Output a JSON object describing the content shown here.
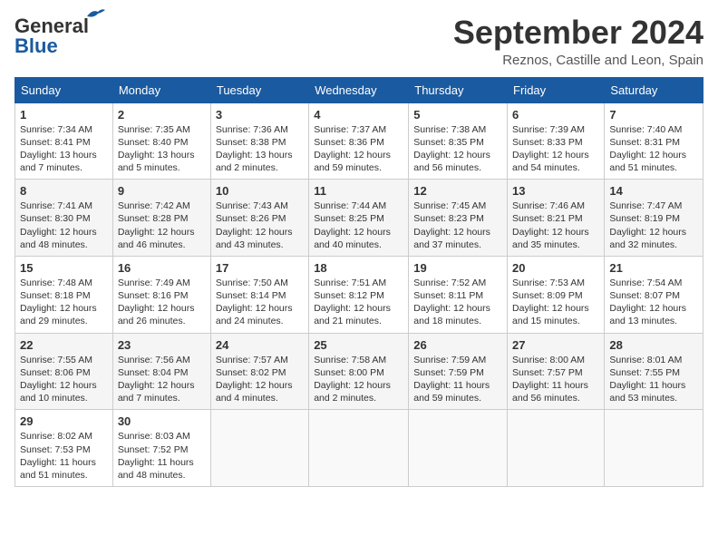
{
  "header": {
    "logo_general": "General",
    "logo_blue": "Blue",
    "month_title": "September 2024",
    "location": "Reznos, Castille and Leon, Spain"
  },
  "days_of_week": [
    "Sunday",
    "Monday",
    "Tuesday",
    "Wednesday",
    "Thursday",
    "Friday",
    "Saturday"
  ],
  "weeks": [
    [
      {
        "day": "1",
        "info": "Sunrise: 7:34 AM\nSunset: 8:41 PM\nDaylight: 13 hours and 7 minutes."
      },
      {
        "day": "2",
        "info": "Sunrise: 7:35 AM\nSunset: 8:40 PM\nDaylight: 13 hours and 5 minutes."
      },
      {
        "day": "3",
        "info": "Sunrise: 7:36 AM\nSunset: 8:38 PM\nDaylight: 13 hours and 2 minutes."
      },
      {
        "day": "4",
        "info": "Sunrise: 7:37 AM\nSunset: 8:36 PM\nDaylight: 12 hours and 59 minutes."
      },
      {
        "day": "5",
        "info": "Sunrise: 7:38 AM\nSunset: 8:35 PM\nDaylight: 12 hours and 56 minutes."
      },
      {
        "day": "6",
        "info": "Sunrise: 7:39 AM\nSunset: 8:33 PM\nDaylight: 12 hours and 54 minutes."
      },
      {
        "day": "7",
        "info": "Sunrise: 7:40 AM\nSunset: 8:31 PM\nDaylight: 12 hours and 51 minutes."
      }
    ],
    [
      {
        "day": "8",
        "info": "Sunrise: 7:41 AM\nSunset: 8:30 PM\nDaylight: 12 hours and 48 minutes."
      },
      {
        "day": "9",
        "info": "Sunrise: 7:42 AM\nSunset: 8:28 PM\nDaylight: 12 hours and 46 minutes."
      },
      {
        "day": "10",
        "info": "Sunrise: 7:43 AM\nSunset: 8:26 PM\nDaylight: 12 hours and 43 minutes."
      },
      {
        "day": "11",
        "info": "Sunrise: 7:44 AM\nSunset: 8:25 PM\nDaylight: 12 hours and 40 minutes."
      },
      {
        "day": "12",
        "info": "Sunrise: 7:45 AM\nSunset: 8:23 PM\nDaylight: 12 hours and 37 minutes."
      },
      {
        "day": "13",
        "info": "Sunrise: 7:46 AM\nSunset: 8:21 PM\nDaylight: 12 hours and 35 minutes."
      },
      {
        "day": "14",
        "info": "Sunrise: 7:47 AM\nSunset: 8:19 PM\nDaylight: 12 hours and 32 minutes."
      }
    ],
    [
      {
        "day": "15",
        "info": "Sunrise: 7:48 AM\nSunset: 8:18 PM\nDaylight: 12 hours and 29 minutes."
      },
      {
        "day": "16",
        "info": "Sunrise: 7:49 AM\nSunset: 8:16 PM\nDaylight: 12 hours and 26 minutes."
      },
      {
        "day": "17",
        "info": "Sunrise: 7:50 AM\nSunset: 8:14 PM\nDaylight: 12 hours and 24 minutes."
      },
      {
        "day": "18",
        "info": "Sunrise: 7:51 AM\nSunset: 8:12 PM\nDaylight: 12 hours and 21 minutes."
      },
      {
        "day": "19",
        "info": "Sunrise: 7:52 AM\nSunset: 8:11 PM\nDaylight: 12 hours and 18 minutes."
      },
      {
        "day": "20",
        "info": "Sunrise: 7:53 AM\nSunset: 8:09 PM\nDaylight: 12 hours and 15 minutes."
      },
      {
        "day": "21",
        "info": "Sunrise: 7:54 AM\nSunset: 8:07 PM\nDaylight: 12 hours and 13 minutes."
      }
    ],
    [
      {
        "day": "22",
        "info": "Sunrise: 7:55 AM\nSunset: 8:06 PM\nDaylight: 12 hours and 10 minutes."
      },
      {
        "day": "23",
        "info": "Sunrise: 7:56 AM\nSunset: 8:04 PM\nDaylight: 12 hours and 7 minutes."
      },
      {
        "day": "24",
        "info": "Sunrise: 7:57 AM\nSunset: 8:02 PM\nDaylight: 12 hours and 4 minutes."
      },
      {
        "day": "25",
        "info": "Sunrise: 7:58 AM\nSunset: 8:00 PM\nDaylight: 12 hours and 2 minutes."
      },
      {
        "day": "26",
        "info": "Sunrise: 7:59 AM\nSunset: 7:59 PM\nDaylight: 11 hours and 59 minutes."
      },
      {
        "day": "27",
        "info": "Sunrise: 8:00 AM\nSunset: 7:57 PM\nDaylight: 11 hours and 56 minutes."
      },
      {
        "day": "28",
        "info": "Sunrise: 8:01 AM\nSunset: 7:55 PM\nDaylight: 11 hours and 53 minutes."
      }
    ],
    [
      {
        "day": "29",
        "info": "Sunrise: 8:02 AM\nSunset: 7:53 PM\nDaylight: 11 hours and 51 minutes."
      },
      {
        "day": "30",
        "info": "Sunrise: 8:03 AM\nSunset: 7:52 PM\nDaylight: 11 hours and 48 minutes."
      },
      {
        "day": "",
        "info": ""
      },
      {
        "day": "",
        "info": ""
      },
      {
        "day": "",
        "info": ""
      },
      {
        "day": "",
        "info": ""
      },
      {
        "day": "",
        "info": ""
      }
    ]
  ]
}
